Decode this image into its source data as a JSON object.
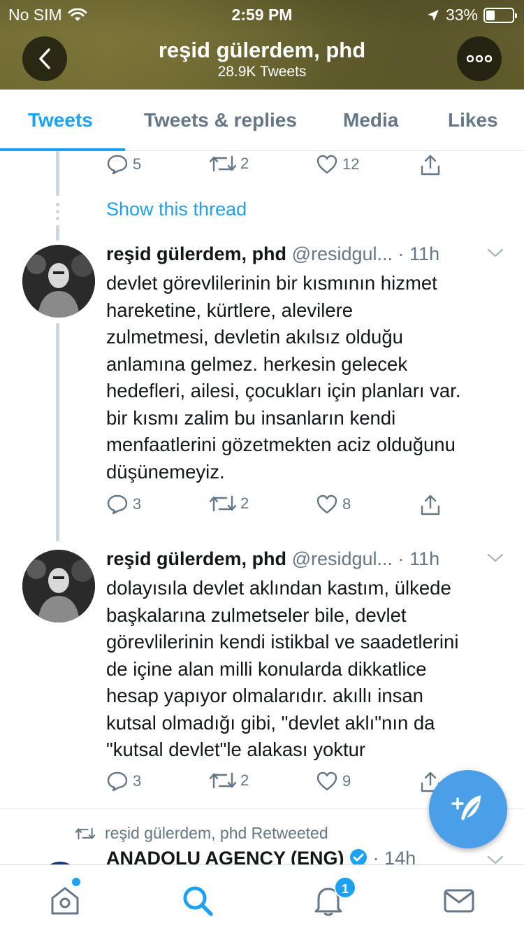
{
  "status_bar": {
    "carrier": "No SIM",
    "time": "2:59 PM",
    "battery": "33%",
    "battery_level": 0.33
  },
  "header": {
    "title": "reşid gülerdem, phd",
    "subtitle": "28.9K Tweets"
  },
  "tabs": [
    {
      "label": "Tweets",
      "active": true
    },
    {
      "label": "Tweets & replies",
      "active": false
    },
    {
      "label": "Media",
      "active": false
    },
    {
      "label": "Likes",
      "active": false
    }
  ],
  "previous_tweet_actions": {
    "replies": "5",
    "retweets": "2",
    "likes": "12"
  },
  "show_thread": "Show this thread",
  "tweets": [
    {
      "name": "reşid gülerdem, phd",
      "handle": "@residgul...",
      "time": "· 11h",
      "text": "devlet görevlilerinin bir kısmının hizmet\nhareketine, kürtlere, alevilere\nzulmetmesi, devletin akılsız olduğu\nanlamına gelmez. herkesin gelecek\nhedefleri, ailesi, çocukları için planları var.\nbir kısmı zalim bu insanların kendi\nmenfaatlerini gözetmekten aciz olduğunu\ndüşünemeyiz.",
      "replies": "3",
      "retweets": "2",
      "likes": "8"
    },
    {
      "name": "reşid gülerdem, phd",
      "handle": "@residgul...",
      "time": "· 11h",
      "text": "dolayısıla devlet aklından kastım, ülkede\nbaşkalarına zulmetseler bile, devlet\ngörevlilerinin kendi istikbal ve saadetlerini\nde içine alan milli konularda dikkatlice\nhesap yapıyor olmalarıdır. akıllı insan\nkutsal olmadığı gibi, \"devlet aklı\"nın da\n\"kutsal devlet\"le alakası yoktur",
      "replies": "3",
      "retweets": "2",
      "likes": "9"
    }
  ],
  "retweet": {
    "label": "reşid gülerdem, phd Retweeted",
    "name": "ANADOLU AGENCY (ENG)",
    "time": "· 14h"
  },
  "bottom_nav": {
    "notifications_badge": "1"
  },
  "colors": {
    "accent": "#1da1f2",
    "muted": "#657786",
    "header_bg": "#66632f"
  }
}
